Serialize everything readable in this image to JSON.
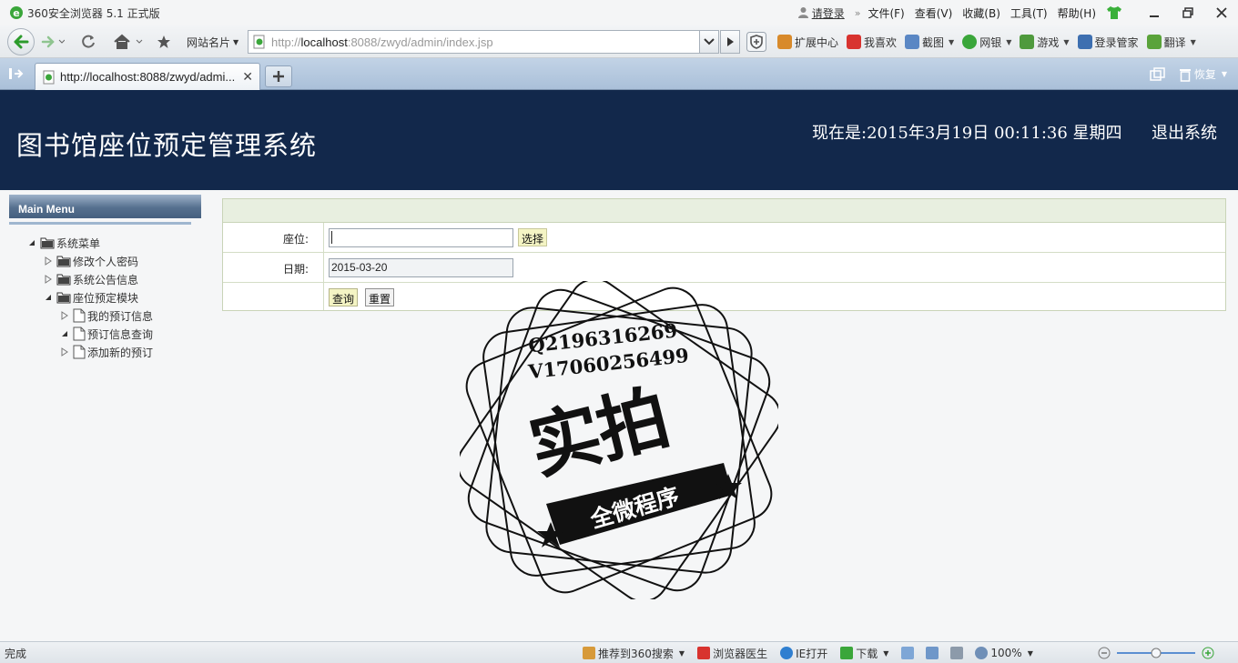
{
  "browser": {
    "title": "360安全浏览器 5.1 正式版",
    "menu": {
      "login": "请登录",
      "file": "文件(F)",
      "view": "查看(V)",
      "favorites": "收藏(B)",
      "tools": "工具(T)",
      "help": "帮助(H)"
    },
    "site_cards": "网站名片",
    "address_prefix": "http://",
    "address_host": "localhost",
    "address_rest": ":8088/zwyd/admin/index.jsp",
    "toolbar": {
      "extensions": "扩展中心",
      "like": "我喜欢",
      "screenshot": "截图",
      "bank": "网银",
      "games": "游戏",
      "login_manager": "登录管家",
      "translate": "翻译"
    },
    "tab_title": "http://localhost:8088/zwyd/admi...",
    "restore": "恢复",
    "status": "完成",
    "status_items": {
      "recommend": "推荐到360搜索",
      "doctor": "浏览器医生",
      "ie_open": "IE打开",
      "download": "下载",
      "zoom": "100%"
    }
  },
  "page": {
    "system_title": "图书馆座位预定管理系统",
    "clock": "现在是:2015年3月19日  00:11:36 星期四",
    "logout": "退出系统",
    "menu_header": "Main Menu",
    "tree": {
      "root": "系统菜单",
      "change_password": "修改个人密码",
      "announcements": "系统公告信息",
      "seat_module": "座位预定模块",
      "my_bookings": "我的预订信息",
      "booking_query": "预订信息查询",
      "add_booking": "添加新的预订"
    },
    "form": {
      "seat_label": "座位:",
      "seat_value": "",
      "choose_button": "选择",
      "date_label": "日期:",
      "date_value": "2015-03-20",
      "query_button": "查询",
      "reset_button": "重置"
    }
  },
  "watermark": {
    "qq": "Q2196316269",
    "wechat": "V17060256499",
    "main": "实拍",
    "ribbon": "全微程序"
  },
  "colors": {
    "banner": "#12284b",
    "menu_header": "#56708f",
    "form_head": "#e8efe0",
    "button_yellow": "#f4f4c4"
  }
}
